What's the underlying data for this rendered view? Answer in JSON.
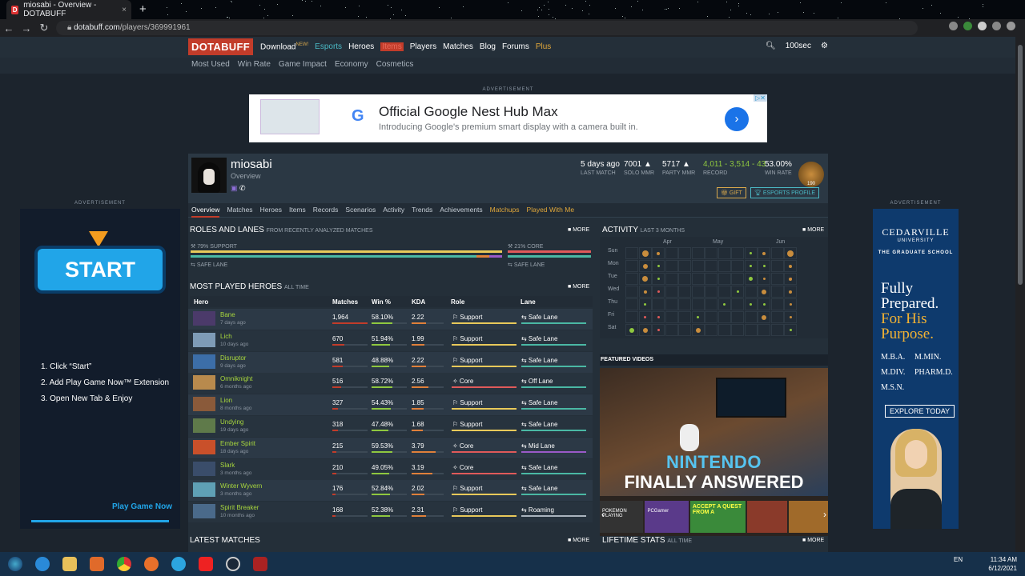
{
  "browser": {
    "tab_title": "miosabi - Overview - DOTABUFF",
    "url_domain": "dotabuff.com",
    "url_path": "/players/369991961",
    "new_tab": "+",
    "tab_close": "×"
  },
  "site": {
    "logo": "DOTABUFF",
    "nav": [
      "Download",
      "Esports",
      "Heroes",
      "Items",
      "Players",
      "Matches",
      "Blog",
      "Forums",
      "Plus"
    ],
    "nav_new_badge": "NEW!",
    "user": "100sec",
    "subnav": [
      "Most Used",
      "Win Rate",
      "Game Impact",
      "Economy",
      "Cosmetics"
    ]
  },
  "ads": {
    "label": "ADVERTISEMENT",
    "top": {
      "headline": "Official Google Nest Hub Max",
      "sub": "Introducing Google's premium smart display with a camera built in.",
      "g": "G"
    },
    "left": {
      "start": "START",
      "steps": [
        "1. Click “Start”",
        "2. Add Play Game Now™ Extension",
        "3. Open New Tab & Enjoy"
      ],
      "play": "Play Game Now"
    },
    "right": {
      "brand": "CEDARVILLE",
      "brand_sub": "UNIVERSITY",
      "school": "THE GRADUATE SCHOOL",
      "tag1": "Fully Prepared.",
      "tag2": "For His Purpose.",
      "degrees": [
        "M.B.A.",
        "M.MIN.",
        "M.DIV.",
        "PHARM.D.",
        "M.S.N."
      ],
      "cta": "EXPLORE TODAY"
    }
  },
  "profile": {
    "name": "miosabi",
    "subtitle": "Overview",
    "stats": [
      {
        "value": "5 days ago",
        "label": "LAST MATCH"
      },
      {
        "value": "7001",
        "label": "SOLO MMR"
      },
      {
        "value": "5717",
        "label": "PARTY MMR"
      },
      {
        "value": "4,011 - 3,514 - 43",
        "label": "RECORD"
      },
      {
        "value": "53.00%",
        "label": "WIN RATE"
      }
    ],
    "medal_rank": "190",
    "gift": "GIFT",
    "esports": "ESPORTS PROFILE"
  },
  "tabs": [
    "Overview",
    "Matches",
    "Heroes",
    "Items",
    "Records",
    "Scenarios",
    "Activity",
    "Trends",
    "Achievements",
    "Matchups",
    "Played With Me"
  ],
  "roles": {
    "title": "ROLES AND LANES",
    "sub": "FROM RECENTLY ANALYZED MATCHES",
    "support": "79% SUPPORT",
    "core": "21% CORE",
    "lane1": "SAFE LANE",
    "lane2": "SAFE LANE",
    "more": "MORE"
  },
  "heroes": {
    "title": "MOST PLAYED HEROES",
    "sub": "ALL TIME",
    "more": "MORE",
    "headers": [
      "Hero",
      "Matches",
      "Win %",
      "KDA",
      "Role",
      "Lane"
    ],
    "rows": [
      {
        "name": "Bane",
        "ago": "7 days ago",
        "matches": "1,964",
        "win": "58.10%",
        "kda": "2.22",
        "role": "Support",
        "lane": "Safe Lane",
        "mfill": 1.0,
        "wfill": 0.58,
        "kfill": 0.45,
        "color": "#4b3a6a"
      },
      {
        "name": "Lich",
        "ago": "10 days ago",
        "matches": "670",
        "win": "51.94%",
        "kda": "1.99",
        "role": "Support",
        "lane": "Safe Lane",
        "mfill": 0.34,
        "wfill": 0.52,
        "kfill": 0.4,
        "color": "#7e9bb6"
      },
      {
        "name": "Disruptor",
        "ago": "9 days ago",
        "matches": "581",
        "win": "48.88%",
        "kda": "2.22",
        "role": "Support",
        "lane": "Safe Lane",
        "mfill": 0.3,
        "wfill": 0.49,
        "kfill": 0.45,
        "color": "#3c6ea8"
      },
      {
        "name": "Omniknight",
        "ago": "6 months ago",
        "matches": "516",
        "win": "58.72%",
        "kda": "2.56",
        "role": "Core",
        "lane": "Off Lane",
        "mfill": 0.26,
        "wfill": 0.59,
        "kfill": 0.52,
        "color": "#b88a4d"
      },
      {
        "name": "Lion",
        "ago": "8 months ago",
        "matches": "327",
        "win": "54.43%",
        "kda": "1.85",
        "role": "Support",
        "lane": "Safe Lane",
        "mfill": 0.17,
        "wfill": 0.54,
        "kfill": 0.37,
        "color": "#8a5a3a"
      },
      {
        "name": "Undying",
        "ago": "19 days ago",
        "matches": "318",
        "win": "47.48%",
        "kda": "1.68",
        "role": "Support",
        "lane": "Safe Lane",
        "mfill": 0.16,
        "wfill": 0.47,
        "kfill": 0.34,
        "color": "#5f7a4a"
      },
      {
        "name": "Ember Spirit",
        "ago": "18 days ago",
        "matches": "215",
        "win": "59.53%",
        "kda": "3.79",
        "role": "Core",
        "lane": "Mid Lane",
        "mfill": 0.11,
        "wfill": 0.6,
        "kfill": 0.76,
        "color": "#c9502a"
      },
      {
        "name": "Slark",
        "ago": "3 months ago",
        "matches": "210",
        "win": "49.05%",
        "kda": "3.19",
        "role": "Core",
        "lane": "Safe Lane",
        "mfill": 0.11,
        "wfill": 0.49,
        "kfill": 0.64,
        "color": "#3a4d6a"
      },
      {
        "name": "Winter Wyvern",
        "ago": "3 months ago",
        "matches": "176",
        "win": "52.84%",
        "kda": "2.02",
        "role": "Support",
        "lane": "Safe Lane",
        "mfill": 0.09,
        "wfill": 0.53,
        "kfill": 0.4,
        "color": "#5fa0b5"
      },
      {
        "name": "Spirit Breaker",
        "ago": "10 months ago",
        "matches": "168",
        "win": "52.38%",
        "kda": "2.31",
        "role": "Support",
        "lane": "Roaming",
        "mfill": 0.09,
        "wfill": 0.52,
        "kfill": 0.46,
        "color": "#4a6a8a"
      }
    ]
  },
  "activity": {
    "title": "ACTIVITY",
    "sub": "LAST 3 MONTHS",
    "more": "MORE",
    "days": [
      "Sun",
      "Mon",
      "Tue",
      "Wed",
      "Thu",
      "Fri",
      "Sat"
    ],
    "months": [
      "Apr",
      "May",
      "Jun"
    ]
  },
  "videos": {
    "title": "FEATURED VIDEOS",
    "line1": "NINTENDO",
    "line2": "FINALLY ANSWERED",
    "thumbs": [
      "POKEMON PLAYING",
      "PCGamer",
      "ACCEPT A QUEST FROM A",
      "",
      ""
    ]
  },
  "latest": {
    "title": "LATEST MATCHES",
    "more": "MORE"
  },
  "lifetime": {
    "title": "LIFETIME STATS",
    "sub": "ALL TIME",
    "more": "MORE"
  },
  "taskbar": {
    "lang": "EN",
    "time": "11:34 AM",
    "date": "6/12/2021"
  }
}
